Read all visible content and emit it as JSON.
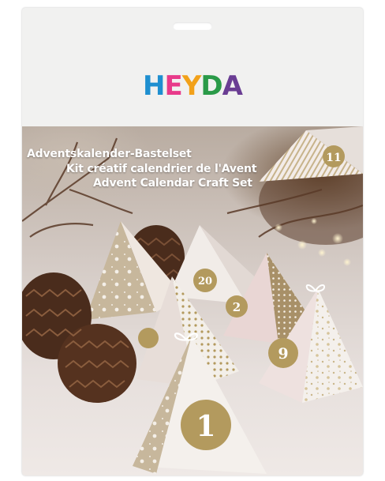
{
  "brand": {
    "name": "HEYDA",
    "letters": [
      {
        "char": "H",
        "color": "#1e8fd0"
      },
      {
        "char": "E",
        "color": "#e83a8a"
      },
      {
        "char": "Y",
        "color": "#f2a11a"
      },
      {
        "char": "D",
        "color": "#2a9a48"
      },
      {
        "char": "A",
        "color": "#6a3d93"
      }
    ]
  },
  "product_titles": {
    "german": "Adventskalender-Bastelset",
    "french": "Kit créatif calendrier de l'Avent",
    "english": "Advent Calendar Craft Set"
  },
  "box_numbers": {
    "front": "1",
    "right": "9",
    "middle_right": "2",
    "middle": "20",
    "back_right": "11"
  },
  "colors": {
    "package_bg": "#f1f1f0",
    "gold": "#b39a5e",
    "box_white": "#f5f1ee",
    "pine_cone": "#4a2c1c"
  }
}
